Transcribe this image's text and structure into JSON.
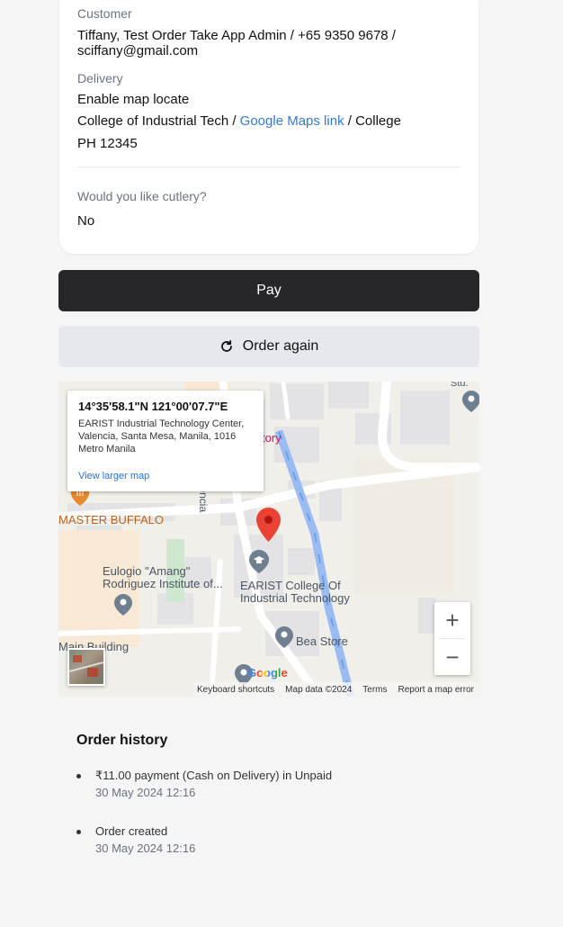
{
  "order": {
    "customer_label": "Customer",
    "customer_line1": "Tiffany, Test Order Take App Admin / +65 9350 9678 /",
    "customer_line2": "sciffany@gmail.com",
    "delivery_label": "Delivery",
    "delivery_mode": "Enable map locate",
    "address_prefix": "College of Industrial Tech / ",
    "maps_link": "Google Maps link",
    "address_suffix": " / College",
    "address_line2": "PH 12345",
    "cutlery_label": "Would you like cutlery?",
    "cutlery_value": "No"
  },
  "actions": {
    "pay_label": "Pay",
    "order_again_label": "Order again",
    "order_again_icon": "refresh-icon"
  },
  "map": {
    "info_coords": "14°35'58.1\"N 121°00'07.7\"E",
    "info_address": "EARIST Industrial Technology Center, Valencia, Santa Mesa, Manila, 1016 Metro Manila",
    "view_larger": "View larger map",
    "labels": {
      "master_buffalo": "MASTER BUFFALO",
      "eulogio_1": "Eulogio \"Amang\"",
      "eulogio_2": "Rodriguez Institute of...",
      "earist_1": "EARIST College Of",
      "earist_2": "Industrial Technology",
      "bea_store": "Bea Store",
      "main_building": "Main Building",
      "valencia": "Valencia",
      "tory": "tory",
      "stu": "Stu."
    },
    "zoom_in": "+",
    "zoom_out": "−",
    "google": "Google",
    "footer": {
      "shortcuts": "Keyboard shortcuts",
      "map_data": "Map data ©2024",
      "terms": "Terms",
      "report": "Report a map error"
    }
  },
  "history": {
    "title": "Order history",
    "items": [
      {
        "text": "₹11.00 payment (Cash on Delivery) in Unpaid",
        "date": "30 May 2024 12:16"
      },
      {
        "text": "Order created",
        "date": "30 May 2024 12:16"
      }
    ]
  }
}
